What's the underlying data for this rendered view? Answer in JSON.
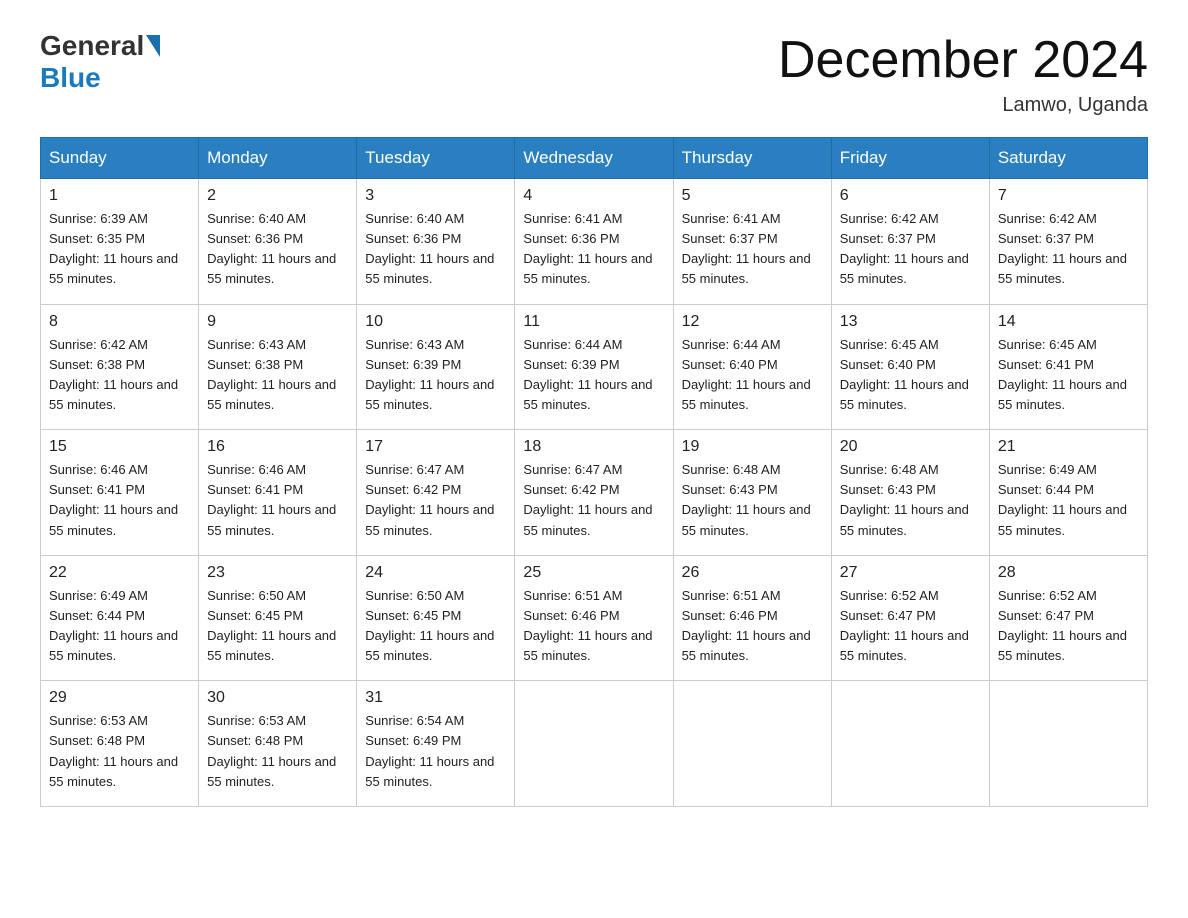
{
  "header": {
    "logo_general": "General",
    "logo_blue": "Blue",
    "month_title": "December 2024",
    "location": "Lamwo, Uganda"
  },
  "weekdays": [
    "Sunday",
    "Monday",
    "Tuesday",
    "Wednesday",
    "Thursday",
    "Friday",
    "Saturday"
  ],
  "weeks": [
    [
      {
        "day": "1",
        "sunrise": "6:39 AM",
        "sunset": "6:35 PM",
        "daylight": "11 hours and 55 minutes."
      },
      {
        "day": "2",
        "sunrise": "6:40 AM",
        "sunset": "6:36 PM",
        "daylight": "11 hours and 55 minutes."
      },
      {
        "day": "3",
        "sunrise": "6:40 AM",
        "sunset": "6:36 PM",
        "daylight": "11 hours and 55 minutes."
      },
      {
        "day": "4",
        "sunrise": "6:41 AM",
        "sunset": "6:36 PM",
        "daylight": "11 hours and 55 minutes."
      },
      {
        "day": "5",
        "sunrise": "6:41 AM",
        "sunset": "6:37 PM",
        "daylight": "11 hours and 55 minutes."
      },
      {
        "day": "6",
        "sunrise": "6:42 AM",
        "sunset": "6:37 PM",
        "daylight": "11 hours and 55 minutes."
      },
      {
        "day": "7",
        "sunrise": "6:42 AM",
        "sunset": "6:37 PM",
        "daylight": "11 hours and 55 minutes."
      }
    ],
    [
      {
        "day": "8",
        "sunrise": "6:42 AM",
        "sunset": "6:38 PM",
        "daylight": "11 hours and 55 minutes."
      },
      {
        "day": "9",
        "sunrise": "6:43 AM",
        "sunset": "6:38 PM",
        "daylight": "11 hours and 55 minutes."
      },
      {
        "day": "10",
        "sunrise": "6:43 AM",
        "sunset": "6:39 PM",
        "daylight": "11 hours and 55 minutes."
      },
      {
        "day": "11",
        "sunrise": "6:44 AM",
        "sunset": "6:39 PM",
        "daylight": "11 hours and 55 minutes."
      },
      {
        "day": "12",
        "sunrise": "6:44 AM",
        "sunset": "6:40 PM",
        "daylight": "11 hours and 55 minutes."
      },
      {
        "day": "13",
        "sunrise": "6:45 AM",
        "sunset": "6:40 PM",
        "daylight": "11 hours and 55 minutes."
      },
      {
        "day": "14",
        "sunrise": "6:45 AM",
        "sunset": "6:41 PM",
        "daylight": "11 hours and 55 minutes."
      }
    ],
    [
      {
        "day": "15",
        "sunrise": "6:46 AM",
        "sunset": "6:41 PM",
        "daylight": "11 hours and 55 minutes."
      },
      {
        "day": "16",
        "sunrise": "6:46 AM",
        "sunset": "6:41 PM",
        "daylight": "11 hours and 55 minutes."
      },
      {
        "day": "17",
        "sunrise": "6:47 AM",
        "sunset": "6:42 PM",
        "daylight": "11 hours and 55 minutes."
      },
      {
        "day": "18",
        "sunrise": "6:47 AM",
        "sunset": "6:42 PM",
        "daylight": "11 hours and 55 minutes."
      },
      {
        "day": "19",
        "sunrise": "6:48 AM",
        "sunset": "6:43 PM",
        "daylight": "11 hours and 55 minutes."
      },
      {
        "day": "20",
        "sunrise": "6:48 AM",
        "sunset": "6:43 PM",
        "daylight": "11 hours and 55 minutes."
      },
      {
        "day": "21",
        "sunrise": "6:49 AM",
        "sunset": "6:44 PM",
        "daylight": "11 hours and 55 minutes."
      }
    ],
    [
      {
        "day": "22",
        "sunrise": "6:49 AM",
        "sunset": "6:44 PM",
        "daylight": "11 hours and 55 minutes."
      },
      {
        "day": "23",
        "sunrise": "6:50 AM",
        "sunset": "6:45 PM",
        "daylight": "11 hours and 55 minutes."
      },
      {
        "day": "24",
        "sunrise": "6:50 AM",
        "sunset": "6:45 PM",
        "daylight": "11 hours and 55 minutes."
      },
      {
        "day": "25",
        "sunrise": "6:51 AM",
        "sunset": "6:46 PM",
        "daylight": "11 hours and 55 minutes."
      },
      {
        "day": "26",
        "sunrise": "6:51 AM",
        "sunset": "6:46 PM",
        "daylight": "11 hours and 55 minutes."
      },
      {
        "day": "27",
        "sunrise": "6:52 AM",
        "sunset": "6:47 PM",
        "daylight": "11 hours and 55 minutes."
      },
      {
        "day": "28",
        "sunrise": "6:52 AM",
        "sunset": "6:47 PM",
        "daylight": "11 hours and 55 minutes."
      }
    ],
    [
      {
        "day": "29",
        "sunrise": "6:53 AM",
        "sunset": "6:48 PM",
        "daylight": "11 hours and 55 minutes."
      },
      {
        "day": "30",
        "sunrise": "6:53 AM",
        "sunset": "6:48 PM",
        "daylight": "11 hours and 55 minutes."
      },
      {
        "day": "31",
        "sunrise": "6:54 AM",
        "sunset": "6:49 PM",
        "daylight": "11 hours and 55 minutes."
      },
      null,
      null,
      null,
      null
    ]
  ]
}
